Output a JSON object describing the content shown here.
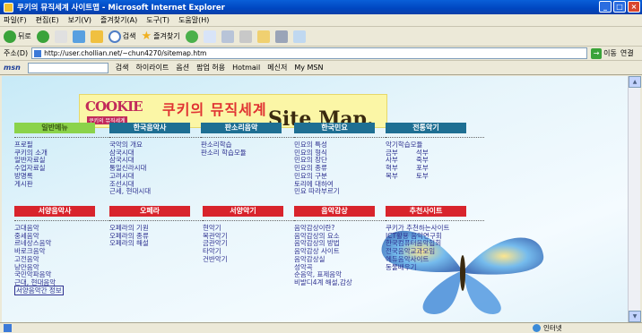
{
  "window": {
    "title": "쿠키의 뮤직세계 사이트맵 - Microsoft Internet Explorer"
  },
  "menu": [
    "파일(F)",
    "편집(E)",
    "보기(V)",
    "즐겨찾기(A)",
    "도구(T)",
    "도움말(H)"
  ],
  "toolbar": {
    "back": "뒤로",
    "search": "검색",
    "favorites": "즐겨찾기"
  },
  "address": {
    "label": "주소(D)",
    "url": "http://user.chollian.net/~chun4270/sitemap.htm",
    "go": "이동",
    "links": "연결"
  },
  "msnbar": {
    "logo": "msn",
    "search": "검색",
    "highlight": "하이라이트",
    "options": "옵션",
    "popup": "팝업 허용",
    "hotmail": "Hotmail",
    "messenger": "메신저",
    "mymsn": "My MSN"
  },
  "logo": {
    "brand": "COOKIE",
    "brand_sub": "쿠키의 뮤직세계",
    "title": "쿠키의 뮤직세계",
    "sitemap": "Site Map."
  },
  "sections": {
    "general": {
      "head": "일반메뉴",
      "items": [
        "프로필",
        "쿠키의 소개",
        "일반자료실",
        "수업자료실",
        "방명록",
        "게시판"
      ]
    },
    "korean_music": {
      "head": "한국음악사",
      "items": [
        "국악의 개요",
        "삼국시대",
        "삼국시대",
        "통일신라시대",
        "고려시대",
        "조선시대",
        "근세, 현대시대"
      ]
    },
    "pansori": {
      "head": "판소리음악",
      "items": [
        "판소리학습",
        "판소리 학습모듈"
      ]
    },
    "minyo": {
      "head": "한국민요",
      "items": [
        "민요의 특성",
        "민요의 형식",
        "민요의 장단",
        "민요의 종류",
        "민요의 구분",
        "토리에 대하여",
        "민요 따라부르기"
      ]
    },
    "instrument": {
      "head": "전통악기",
      "rows": [
        [
          "악기학습모듈",
          ""
        ],
        [
          "금부",
          "석부"
        ],
        [
          "사부",
          "죽부"
        ],
        [
          "혁부",
          "포부"
        ],
        [
          "목부",
          "토부"
        ]
      ]
    },
    "western": {
      "head": "서양음악사",
      "items": [
        "고대음악",
        "중세음악",
        "르네상스음악",
        "바로크음악",
        "고전음악",
        "낭만음악",
        "국민악파음악",
        "근대, 현대음악",
        "서양음악간 정보"
      ]
    },
    "opera": {
      "head": "오페라",
      "items": [
        "오페라의 기원",
        "오페라의 종류",
        "오페라의 해설"
      ]
    },
    "western_inst": {
      "head": "서양악기",
      "items": [
        "현악기",
        "목관악기",
        "금관악기",
        "타악기",
        "건반악기"
      ]
    },
    "appreciation": {
      "head": "음악감상",
      "items": [
        "음악감상이란?",
        "음악감상의 요소",
        "음악감상의 방법",
        "음악감상 사이트",
        "음악감상실",
        "성악곡",
        "순음악, 표제음악",
        "비발디4계 해설,감상"
      ]
    },
    "recommend": {
      "head": "추천사이트",
      "items": [
        "쿠키가 추천하는사이트",
        "ICT활용 음악연구회",
        "한국컴퓨터음악협회",
        "전국음악교과모임",
        "에듀음악사이트",
        "동물배우기"
      ]
    }
  },
  "status": {
    "zone": "인터넷"
  },
  "colors": {
    "accent_green": "#8bd34a",
    "accent_blue": "#1e6f93",
    "accent_red": "#d8242c",
    "link": "#2e3190"
  }
}
